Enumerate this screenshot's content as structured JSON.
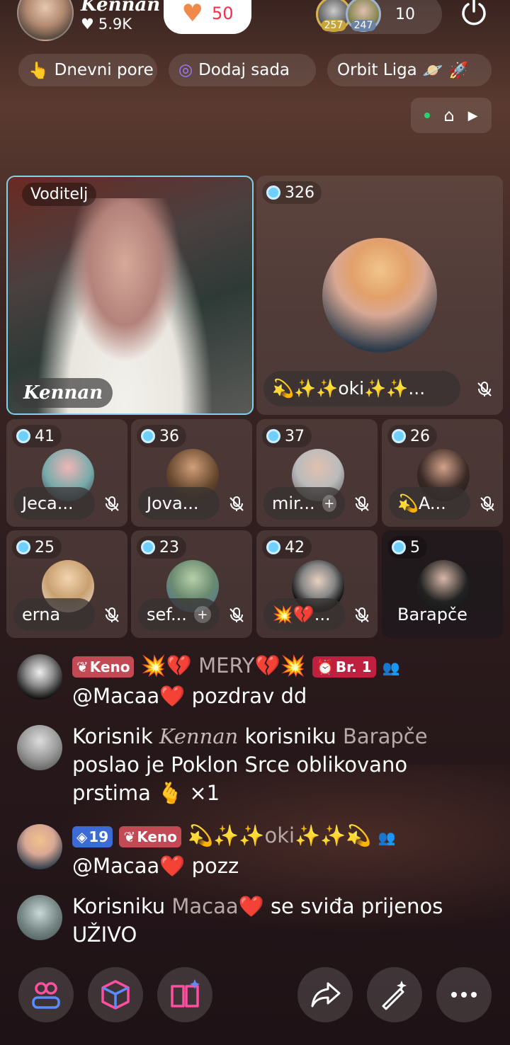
{
  "header": {
    "host_name": "Kennan",
    "host_likes": "5.9K",
    "follow_count": "50",
    "viewer_badges": [
      "257",
      "247"
    ],
    "viewer_count": "10"
  },
  "chips": [
    {
      "label": "Dnevni pore"
    },
    {
      "label": "Dodaj sada"
    },
    {
      "label": "Orbit Liga"
    }
  ],
  "stage": {
    "host_badge": "Voditelj",
    "host_label": "Kennan",
    "big_guest": {
      "score": "326",
      "name": "💫✨✨oki✨✨..."
    },
    "guests": [
      {
        "score": "41",
        "name": "Jeca..."
      },
      {
        "score": "36",
        "name": "Jova..."
      },
      {
        "score": "37",
        "name": "mir..."
      },
      {
        "score": "26",
        "name": "💫A..."
      },
      {
        "score": "25",
        "name": "erna"
      },
      {
        "score": "23",
        "name": "sef..."
      },
      {
        "score": "42",
        "name": "💥💔..."
      },
      {
        "score": "5",
        "name": "Barapče"
      }
    ]
  },
  "chat": [
    {
      "keno": "Keno",
      "user": "💥💔 MERY💔💥",
      "rank": "Br. 1",
      "text": "@Macaa❤️ pozdrav dd"
    },
    {
      "p1": "Korisnik",
      "sender": "Kennan",
      "p2": "korisniku",
      "receiver": "Barapče",
      "p3": "poslao je Poklon Srce oblikovano prstima 🫰 ×1"
    },
    {
      "level": "19",
      "keno": "Keno",
      "user": "💫✨✨oki✨✨💫",
      "text": "@Macaa❤️ pozz"
    },
    {
      "p1": "Korisniku",
      "user": "Macaa❤️",
      "p2": "se sviđa prijenos UŽIVO"
    }
  ],
  "colors": {
    "accent_pink": "#ff2b4d",
    "host_border": "#7fd3e6",
    "keno_tag": "#c24a55",
    "level_tag": "#3d6bd6"
  }
}
